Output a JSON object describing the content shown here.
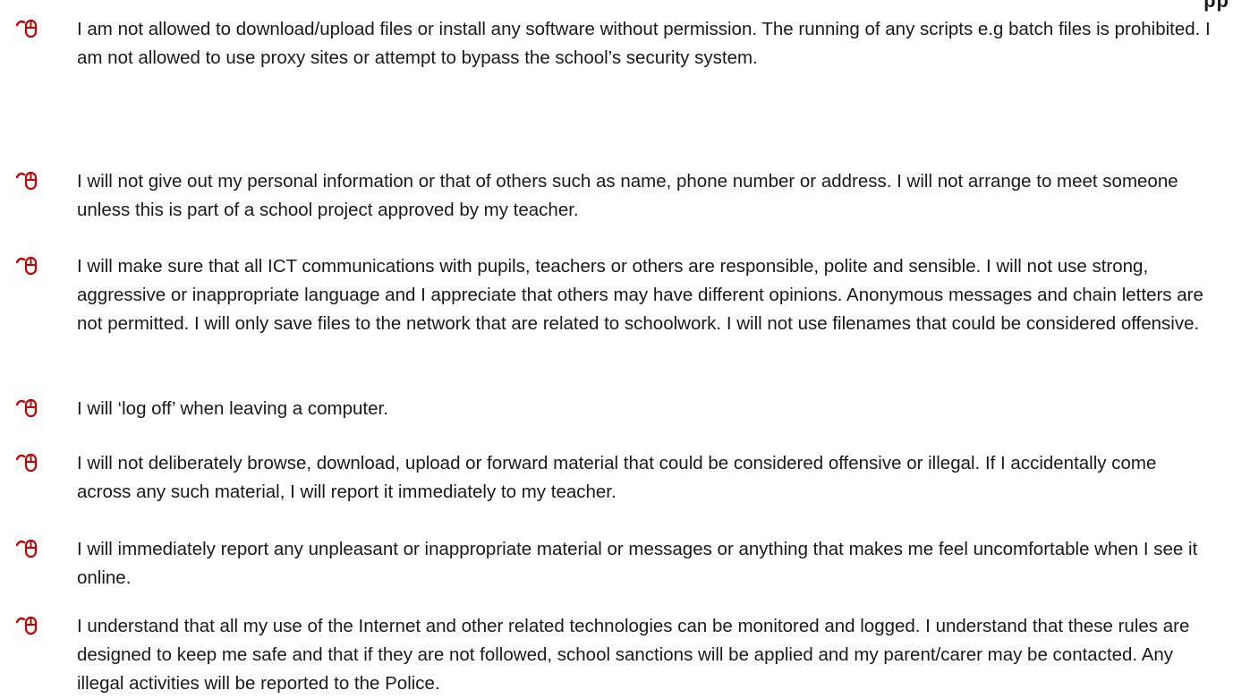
{
  "corner_text": "pp",
  "rules": [
    {
      "icon": "mouse-icon",
      "text": "I am not allowed to download/upload files or install any software without permission. The running of any scripts e.g batch files is prohibited. I am not allowed to use proxy sites or attempt to bypass the school’s security system."
    },
    {
      "icon": "mouse-icon",
      "text": "I will not give out my personal information or that of others such as name, phone number or address.  I will not arrange to meet someone unless this is part of a school project approved by my teacher."
    },
    {
      "icon": "mouse-icon",
      "text": "I will make sure that all ICT communications with pupils, teachers or others are responsible, polite and sensible.  I will not use strong, aggressive or inappropriate language and I appreciate that others may have different opinions. Anonymous messages and chain letters are not permitted. I will only save files to the network that are related to schoolwork.   I will not use filenames that could be considered offensive."
    },
    {
      "icon": "mouse-icon",
      "text": "I will ‘log off’ when leaving a computer."
    },
    {
      "icon": "mouse-icon",
      "text": "I will not deliberately browse, download, upload or forward material that could be considered offensive or illegal.   If I accidentally come across any such material, I will report it immediately to my teacher."
    },
    {
      "icon": "mouse-icon",
      "text": "I will immediately report any unpleasant or inappropriate material or messages or anything that makes me feel uncomfortable when I see it online."
    },
    {
      "icon": "mouse-icon",
      "text": "I understand that all my use of the Internet and other related technologies can be monitored and logged. I understand that these rules are designed to keep me safe and that if they are not followed, school sanctions will be applied and my parent/carer may be contacted. Any illegal activities will be reported to the Police."
    }
  ],
  "colors": {
    "icon": "#c00000",
    "text": "#1a1a1a"
  }
}
